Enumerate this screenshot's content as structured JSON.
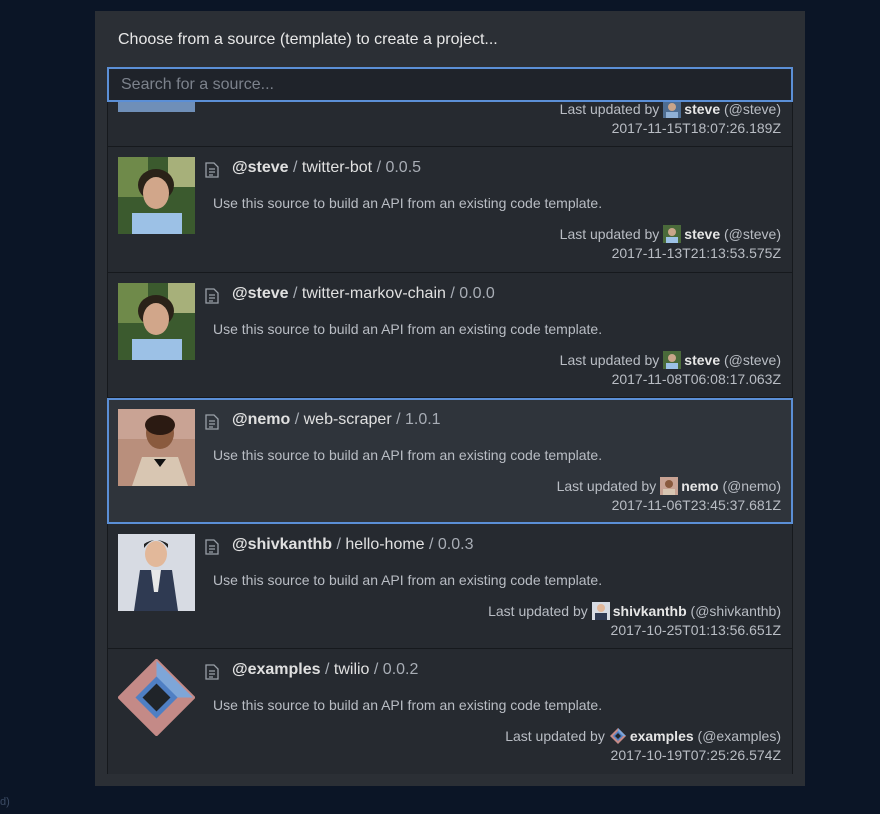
{
  "dialog": {
    "title": "Choose from a source (template) to create a project...",
    "search_placeholder": "Search for a source..."
  },
  "background_fragment": "d)",
  "partial_item": {
    "label": "Last updated by",
    "user": "steve",
    "handle": "(@steve)",
    "timestamp": "2017-11-15T18:07:26.189Z"
  },
  "items": [
    {
      "owner": "@steve",
      "sep": " / ",
      "name": "twitter-bot",
      "version": " / 0.0.5",
      "description": "Use this source to build an API from an existing code template.",
      "label": "Last updated by",
      "user": "steve",
      "handle": "(@steve)",
      "timestamp": "2017-11-13T21:13:53.575Z",
      "avatar": "steve",
      "selected": false
    },
    {
      "owner": "@steve",
      "sep": " / ",
      "name": "twitter-markov-chain",
      "version": " / 0.0.0",
      "description": "Use this source to build an API from an existing code template.",
      "label": "Last updated by",
      "user": "steve",
      "handle": "(@steve)",
      "timestamp": "2017-11-08T06:08:17.063Z",
      "avatar": "steve",
      "selected": false
    },
    {
      "owner": "@nemo",
      "sep": " / ",
      "name": "web-scraper",
      "version": " / 1.0.1",
      "description": "Use this source to build an API from an existing code template.",
      "label": "Last updated by",
      "user": "nemo",
      "handle": "(@nemo)",
      "timestamp": "2017-11-06T23:45:37.681Z",
      "avatar": "nemo",
      "selected": true
    },
    {
      "owner": "@shivkanthb",
      "sep": " / ",
      "name": "hello-home",
      "version": " / 0.0.3",
      "description": "Use this source to build an API from an existing code template.",
      "label": "Last updated by",
      "user": "shivkanthb",
      "handle": "(@shivkanthb)",
      "timestamp": "2017-10-25T01:13:56.651Z",
      "avatar": "shivkanthb",
      "selected": false
    },
    {
      "owner": "@examples",
      "sep": " / ",
      "name": "twilio",
      "version": " / 0.0.2",
      "description": "Use this source to build an API from an existing code template.",
      "label": "Last updated by",
      "user": "examples",
      "handle": "(@examples)",
      "timestamp": "2017-10-19T07:25:26.574Z",
      "avatar": "examples",
      "selected": false
    }
  ],
  "colors": {
    "accent": "#5b8fd6",
    "modal_bg": "#2b2f35",
    "page_bg": "#0b1526"
  },
  "icons": {
    "doc": "document-icon"
  }
}
